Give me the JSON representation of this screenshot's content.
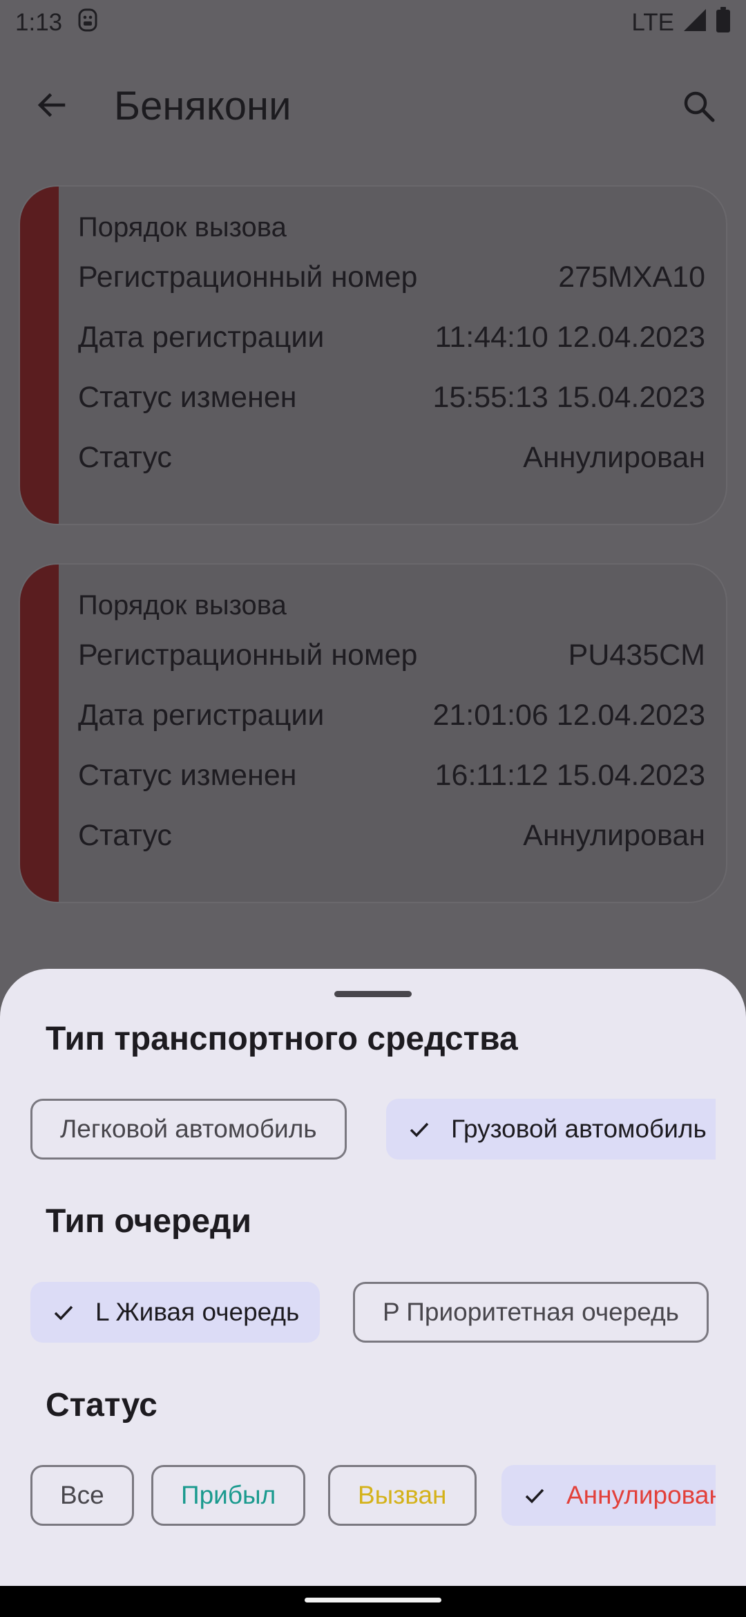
{
  "status_bar": {
    "time": "1:13",
    "network": "LTE"
  },
  "app_bar": {
    "title": "Бенякони"
  },
  "cards": [
    {
      "heading": "Порядок вызова",
      "rows": [
        {
          "label": "Регистрационный номер",
          "value": "275MXA10"
        },
        {
          "label": "Дата регистрации",
          "value": "11:44:10 12.04.2023"
        },
        {
          "label": "Статус изменен",
          "value": "15:55:13 15.04.2023"
        },
        {
          "label": "Статус",
          "value": "Аннулирован"
        }
      ]
    },
    {
      "heading": "Порядок вызова",
      "rows": [
        {
          "label": "Регистрационный номер",
          "value": "PU435CM"
        },
        {
          "label": "Дата регистрации",
          "value": "21:01:06 12.04.2023"
        },
        {
          "label": "Статус изменен",
          "value": "16:11:12 15.04.2023"
        },
        {
          "label": "Статус",
          "value": "Аннулирован"
        }
      ]
    }
  ],
  "filter_sheet": {
    "vehicle_type": {
      "title": "Тип транспортного средства",
      "options": [
        {
          "label": "Легковой автомобиль",
          "selected": false
        },
        {
          "label": "Грузовой автомобиль",
          "selected": true
        }
      ]
    },
    "queue_type": {
      "title": "Тип очереди",
      "options": [
        {
          "label": "L Живая очередь",
          "selected": true
        },
        {
          "label": "P Приоритетная очередь",
          "selected": false
        }
      ]
    },
    "status": {
      "title": "Статус",
      "options": [
        {
          "label": "Все",
          "selected": false,
          "color": "#48464c"
        },
        {
          "label": "Прибыл",
          "selected": false,
          "color": "#1a9a8e"
        },
        {
          "label": "Вызван",
          "selected": false,
          "color": "#d4b21a"
        },
        {
          "label": "Аннулирован",
          "selected": true,
          "color": "#e2403a"
        }
      ]
    }
  },
  "colors": {
    "scrim": "#626064",
    "card_stripe": "#5a1d1f",
    "sheet_bg": "#e9e7f1",
    "chip_selected_bg": "#dcdcf6"
  }
}
